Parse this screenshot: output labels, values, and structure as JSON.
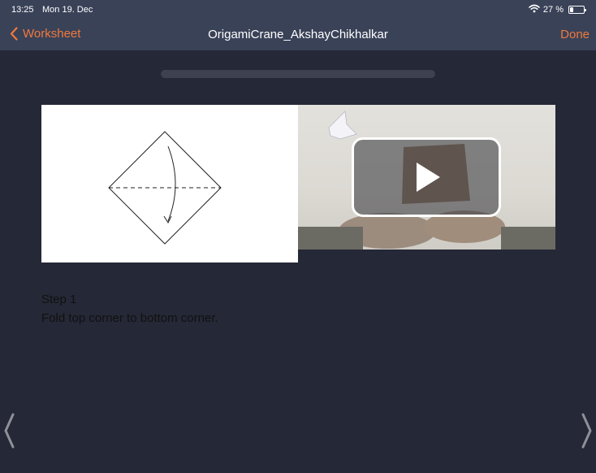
{
  "status_bar": {
    "time": "13:25",
    "date": "Mon 19. Dec",
    "battery_text": "27 %",
    "battery_level": 0.27,
    "icons": [
      "wifi-icon",
      "battery-icon"
    ]
  },
  "nav": {
    "back_label": "Worksheet",
    "title": "OrigamiCrane_AkshayChikhalkar",
    "done_label": "Done",
    "accent_color": "#f07a3c"
  },
  "step": {
    "title": "Step 1",
    "instruction": "Fold top corner to bottom corner."
  },
  "media": {
    "diagram_icon": "fold-diagram",
    "video_icon": "play-icon"
  },
  "pager": {
    "prev_icon": "chevron-left-icon",
    "next_icon": "chevron-right-icon"
  },
  "colors": {
    "background": "#252836",
    "bar": "#3a4258",
    "accent": "#f07a3c"
  }
}
